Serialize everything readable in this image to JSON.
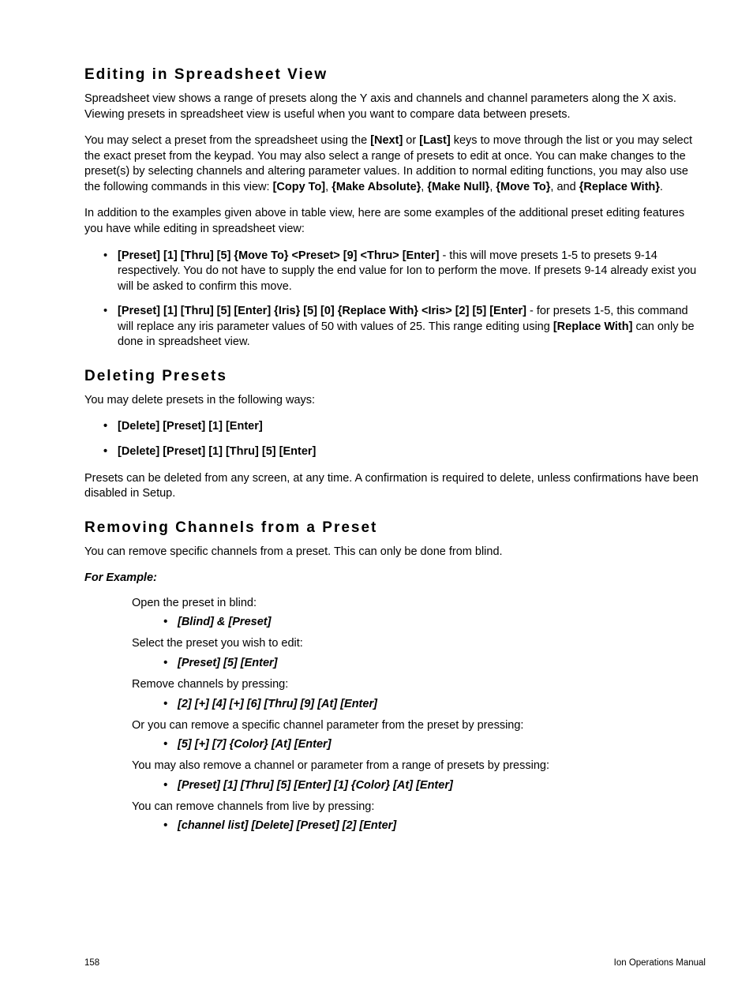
{
  "section1": {
    "heading": "Editing in Spreadsheet View",
    "p1": "Spreadsheet view shows a range of presets along the Y axis and channels and channel parameters along the X axis. Viewing presets in spreadsheet view is useful when you want to compare data between presets.",
    "p2_a": "You may select a preset from the spreadsheet using the ",
    "p2_b": "[Next]",
    "p2_c": " or ",
    "p2_d": "[Last]",
    "p2_e": " keys to move through the list or you may select the exact preset from the keypad. You may also select a range of presets to edit at once. You can make changes to the preset(s) by selecting channels and altering parameter values. In addition to normal editing functions, you may also use the following commands in this view: ",
    "p2_f": "[Copy To]",
    "p2_g": ", ",
    "p2_h": "{Make Absolute}",
    "p2_i": ", ",
    "p2_j": "{Make Null}",
    "p2_k": ", ",
    "p2_l": "{Move To}",
    "p2_m": ", and ",
    "p2_n": "{Replace With}",
    "p2_o": ".",
    "p3": "In addition to the examples given above in table view, here are some examples of the additional preset editing features you have while editing in spreadsheet view:",
    "b1_a": "[Preset] [1] [Thru] [5] {Move To} <Preset> [9] <Thru> [Enter]",
    "b1_b": " - this will move presets 1-5 to presets 9-14 respectively. You do not have to supply the end value for Ion to perform the move. If presets 9-14 already exist you will be asked to confirm this move.",
    "b2_a": "[Preset] [1] [Thru] [5] [Enter] {Iris} [5] [0] {Replace With} <Iris> [2] [5] [Enter]",
    "b2_b": " - for presets 1-5, this command will replace any iris parameter values of 50 with values of 25. This range editing using ",
    "b2_c": "[Replace With]",
    "b2_d": " can only be done in spreadsheet view."
  },
  "section2": {
    "heading": "Deleting Presets",
    "p1": "You may delete presets in the following ways:",
    "b1": "[Delete] [Preset] [1] [Enter]",
    "b2": "[Delete] [Preset] [1] [Thru] [5] [Enter]",
    "p2": "Presets can be deleted from any screen, at any time. A confirmation is required to delete, unless confirmations have been disabled in Setup."
  },
  "section3": {
    "heading": "Removing Channels from a Preset",
    "p1": "You can remove specific channels from a preset. This can only be done from blind.",
    "example": "For Example:",
    "s1": "Open the preset in blind:",
    "s1b": "[Blind] & [Preset]",
    "s2": "Select the preset you wish to edit:",
    "s2b": "[Preset] [5] [Enter]",
    "s3": "Remove channels by pressing:",
    "s3b": "[2] [+] [4] [+] [6] [Thru] [9] [At] [Enter]",
    "s4": "Or you can remove a specific channel parameter from the preset by pressing:",
    "s4b": "[5] [+] [7] {Color} [At] [Enter]",
    "s5": "You may also remove a channel or parameter from a range of presets by pressing:",
    "s5b": "[Preset] [1] [Thru] [5] [Enter] [1] {Color} [At] [Enter]",
    "s6": "You can remove channels from live by pressing:",
    "s6b": "[channel list] [Delete] [Preset] [2] [Enter]"
  },
  "footer": {
    "pagenum": "158",
    "manual": "Ion Operations Manual"
  }
}
